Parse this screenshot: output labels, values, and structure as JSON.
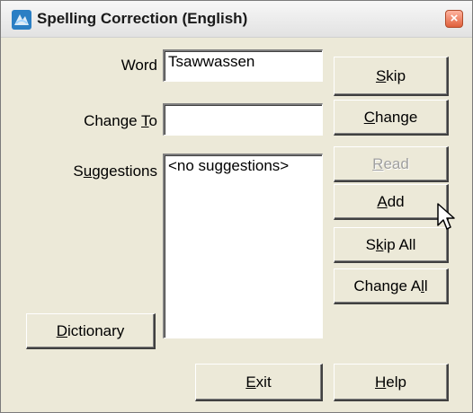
{
  "window": {
    "title": "Spelling Correction (English)",
    "close_symbol": "×",
    "icon": "app-icon"
  },
  "form": {
    "word_label": "Word",
    "word_value": "Tsawwassen",
    "change_to_label_pre": "Change ",
    "change_to_label_key": "T",
    "change_to_label_post": "o",
    "change_to_value": "",
    "suggestions_label_pre": "S",
    "suggestions_label_key": "u",
    "suggestions_label_post": "ggestions",
    "suggestions": [
      "<no suggestions>"
    ]
  },
  "buttons": {
    "skip": {
      "key": "S",
      "rest": "kip"
    },
    "change": {
      "key": "C",
      "rest": "hange"
    },
    "read": {
      "key": "R",
      "rest": "ead",
      "disabled": true
    },
    "add": {
      "key": "A",
      "rest": "dd"
    },
    "skip_all": {
      "pre": "S",
      "key": "k",
      "rest": "ip All"
    },
    "change_all": {
      "pre": "Change A",
      "key": "l",
      "rest": "l"
    },
    "dictionary": {
      "key": "D",
      "rest": "ictionary"
    },
    "exit": {
      "key": "E",
      "rest": "xit"
    },
    "help": {
      "key": "H",
      "rest": "elp"
    }
  },
  "colors": {
    "dialog_bg": "#ece9d8",
    "disabled_text": "#a0a0a0"
  }
}
